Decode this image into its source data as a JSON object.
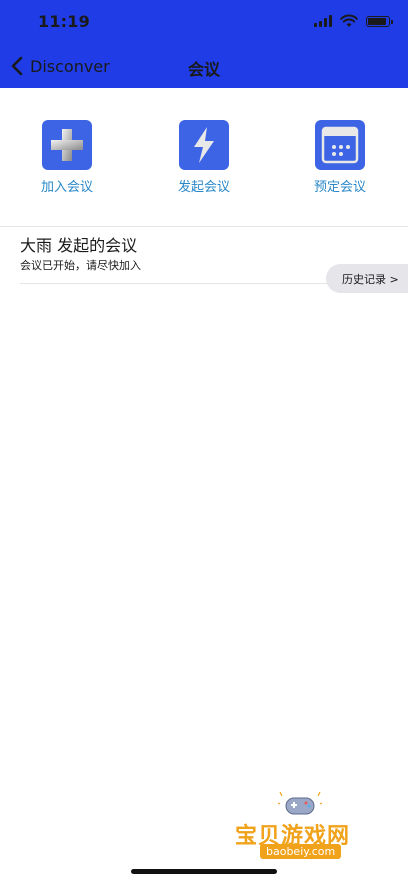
{
  "status_bar": {
    "time": "11:19"
  },
  "nav": {
    "back_label": "Disconver",
    "title": "会议"
  },
  "actions": [
    {
      "label": "加入会议",
      "icon": "plus-icon"
    },
    {
      "label": "发起会议",
      "icon": "lightning-icon"
    },
    {
      "label": "预定会议",
      "icon": "calendar-icon"
    }
  ],
  "meeting": {
    "title": "大雨 发起的会议",
    "status": "会议已开始，请尽快加入"
  },
  "history_button": {
    "label": "历史记录 >"
  },
  "watermark": {
    "text": "宝贝游戏网",
    "url": "baobeiy.com"
  },
  "colors": {
    "header_bg": "#1f3ce6",
    "tile_bg": "#3c64e4",
    "action_label": "#2a88c8",
    "history_bg": "#e5e5ea"
  }
}
